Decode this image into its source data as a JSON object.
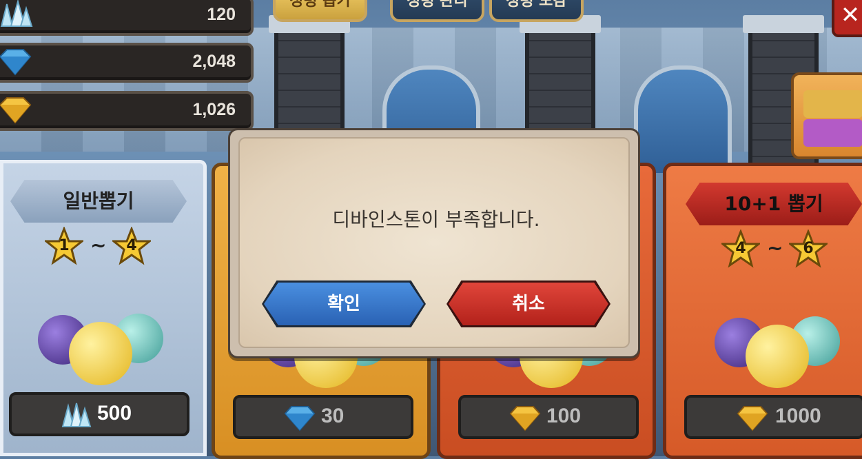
{
  "currencies": [
    {
      "icon": "crystal-icon",
      "value": "120"
    },
    {
      "icon": "diamond-icon",
      "value": "2,048"
    },
    {
      "icon": "gold-gem-icon",
      "value": "1,026"
    }
  ],
  "top_tabs": [
    {
      "label": "정령 뽑기",
      "active": true
    },
    {
      "label": "정령 관리",
      "active": false
    },
    {
      "label": "정령 도감",
      "active": false
    }
  ],
  "cards": [
    {
      "title": "일반뽑기",
      "star_min": "1",
      "star_max": "4",
      "tilde": "~",
      "price_icon": "crystal-icon",
      "price": "500"
    },
    {
      "title": "",
      "price_icon": "diamond-icon",
      "price": "30"
    },
    {
      "title": "",
      "price_icon": "gold-gem-icon",
      "price": "100"
    },
    {
      "title": "10+1 뽑기",
      "star_min": "4",
      "star_max": "6",
      "tilde": "~",
      "price_icon": "gold-gem-icon",
      "price": "1000"
    }
  ],
  "dialog": {
    "message": "디바인스톤이 부족합니다.",
    "confirm_label": "확인",
    "cancel_label": "취소"
  },
  "colors": {
    "confirm": "#2a62b4",
    "cancel": "#b3221b",
    "dialog_bg": "#e4d4bd"
  }
}
